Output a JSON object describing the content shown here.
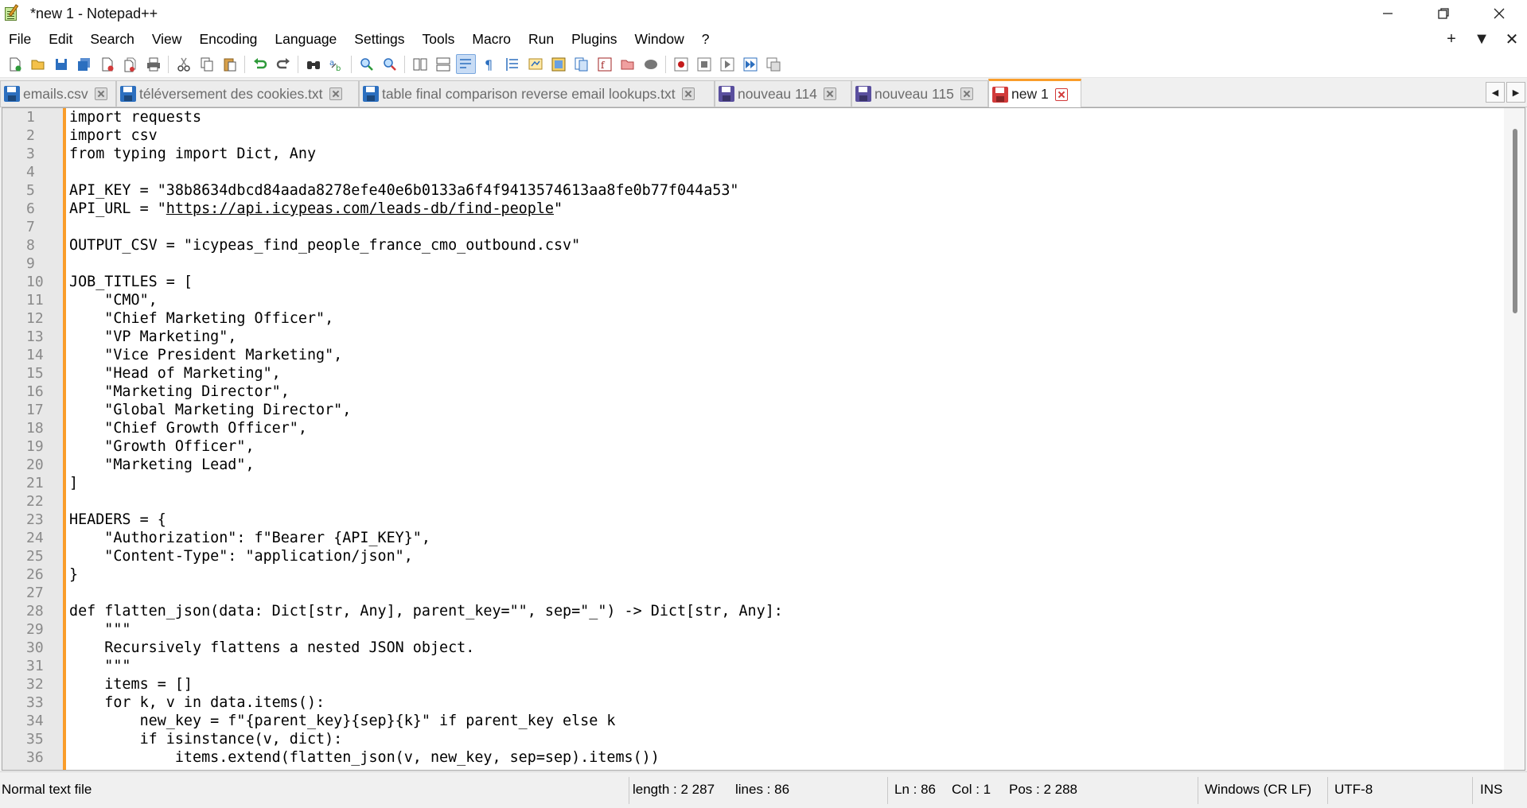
{
  "window": {
    "title": "*new 1 - Notepad++",
    "icon": "notepad-plus-plus-icon"
  },
  "menu": [
    "File",
    "Edit",
    "Search",
    "View",
    "Encoding",
    "Language",
    "Settings",
    "Tools",
    "Macro",
    "Run",
    "Plugins",
    "Window",
    "?"
  ],
  "menu_right": [
    "+",
    "▼",
    "✕"
  ],
  "tabs": [
    {
      "label": "emails.csv",
      "color": "#2c6fbf"
    },
    {
      "label": "téléversement des cookies.txt",
      "color": "#2c6fbf"
    },
    {
      "label": "table final comparison reverse email lookups.txt",
      "color": "#2c6fbf"
    },
    {
      "label": "nouveau 114",
      "color": "#5a4f9e"
    },
    {
      "label": "nouveau 115",
      "color": "#5a4f9e"
    },
    {
      "label": "new 1",
      "color": "#d23a3a",
      "active": true
    }
  ],
  "tab_nav": [
    "◀",
    "▶"
  ],
  "editor": {
    "lines": [
      "import requests",
      "import csv",
      "from typing import Dict, Any",
      "",
      "API_KEY = \"38b8634dbcd84aada8278efe40e6b0133a6f4f9413574613aa8fe0b77f044a53\"",
      "API_URL = \"https://api.icypeas.com/leads-db/find-people\"",
      "",
      "OUTPUT_CSV = \"icypeas_find_people_france_cmo_outbound.csv\"",
      "",
      "JOB_TITLES = [",
      "    \"CMO\",",
      "    \"Chief Marketing Officer\",",
      "    \"VP Marketing\",",
      "    \"Vice President Marketing\",",
      "    \"Head of Marketing\",",
      "    \"Marketing Director\",",
      "    \"Global Marketing Director\",",
      "    \"Chief Growth Officer\",",
      "    \"Growth Officer\",",
      "    \"Marketing Lead\",",
      "]",
      "",
      "HEADERS = {",
      "    \"Authorization\": f\"Bearer {API_KEY}\",",
      "    \"Content-Type\": \"application/json\",",
      "}",
      "",
      "def flatten_json(data: Dict[str, Any], parent_key=\"\", sep=\"_\") -> Dict[str, Any]:",
      "    \"\"\"",
      "    Recursively flattens a nested JSON object.",
      "    \"\"\"",
      "    items = []",
      "    for k, v in data.items():",
      "        new_key = f\"{parent_key}{sep}{k}\" if parent_key else k",
      "        if isinstance(v, dict):",
      "            items.extend(flatten_json(v, new_key, sep=sep).items())"
    ],
    "url_line": {
      "prefix": "API_URL = \"",
      "url": "https://api.icypeas.com/leads-db/find-people",
      "suffix": "\""
    }
  },
  "status": {
    "file_type": "Normal text file",
    "length": "length : 2 287",
    "lines": "lines : 86",
    "ln": "Ln : 86",
    "col": "Col : 1",
    "pos": "Pos : 2 288",
    "eol": "Windows (CR LF)",
    "encoding": "UTF-8",
    "mode": "INS"
  },
  "colors": {
    "accent_orange": "#fa9d2a",
    "gutter": "#e8e8e8",
    "active_close": "#d23a3a"
  }
}
